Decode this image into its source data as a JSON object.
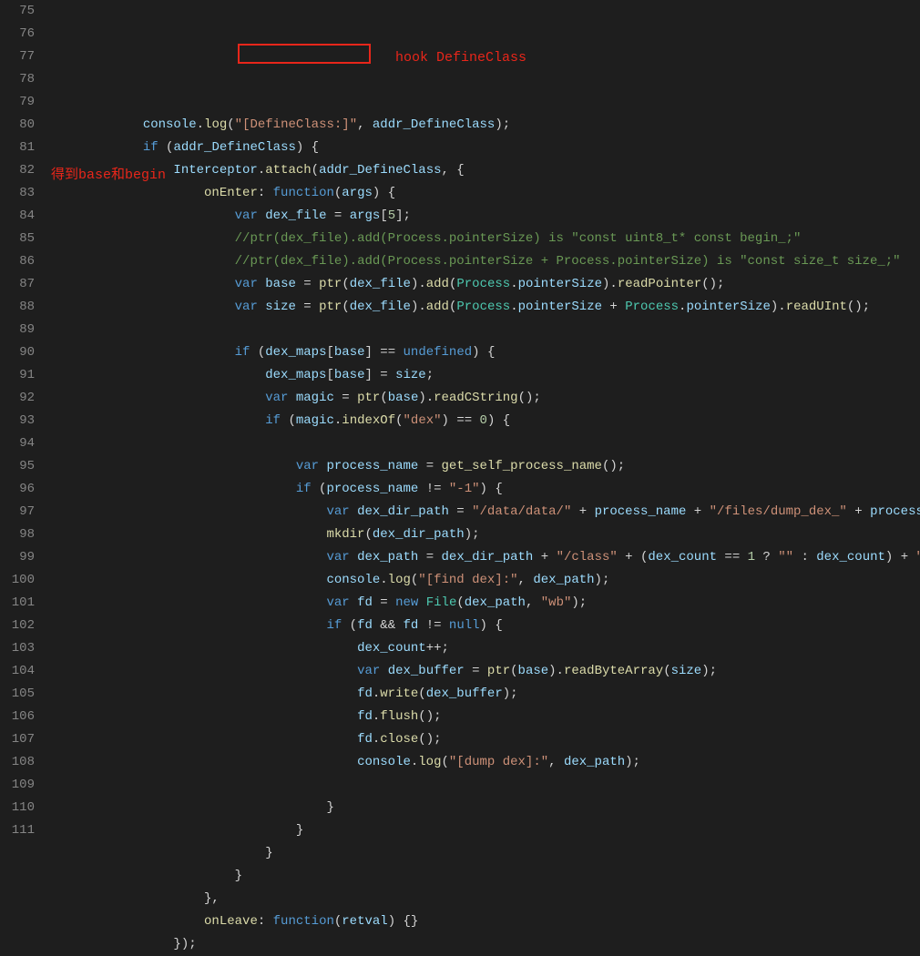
{
  "lineStart": 75,
  "lineEnd": 111,
  "annotations": {
    "a1": "hook DefineClass",
    "a2": "得到base和begin"
  },
  "tokens": {
    "l75": [
      {
        "c": "ident",
        "t": "console"
      },
      {
        "c": "pun",
        "t": "."
      },
      {
        "c": "func",
        "t": "log"
      },
      {
        "c": "pun",
        "t": "("
      },
      {
        "c": "str",
        "t": "\"[DefineClass:]\""
      },
      {
        "c": "pun",
        "t": ", "
      },
      {
        "c": "ident",
        "t": "addr_DefineClass"
      },
      {
        "c": "pun",
        "t": ");"
      }
    ],
    "l76": [
      {
        "c": "kw",
        "t": "if"
      },
      {
        "c": "pun",
        "t": " ("
      },
      {
        "c": "ident",
        "t": "addr_DefineClass"
      },
      {
        "c": "pun",
        "t": ") {"
      }
    ],
    "l77": [
      {
        "c": "ident",
        "t": "Interceptor"
      },
      {
        "c": "pun",
        "t": "."
      },
      {
        "c": "func",
        "t": "attach"
      },
      {
        "c": "pun",
        "t": "("
      },
      {
        "c": "ident",
        "t": "addr_DefineClass"
      },
      {
        "c": "pun",
        "t": ", {"
      }
    ],
    "l78": [
      {
        "c": "func",
        "t": "onEnter"
      },
      {
        "c": "pun",
        "t": ": "
      },
      {
        "c": "kw",
        "t": "function"
      },
      {
        "c": "pun",
        "t": "("
      },
      {
        "c": "ident",
        "t": "args"
      },
      {
        "c": "pun",
        "t": ") {"
      }
    ],
    "l79": [
      {
        "c": "kw",
        "t": "var"
      },
      {
        "c": "pun",
        "t": " "
      },
      {
        "c": "ident",
        "t": "dex_file"
      },
      {
        "c": "pun",
        "t": " = "
      },
      {
        "c": "ident",
        "t": "args"
      },
      {
        "c": "pun",
        "t": "["
      },
      {
        "c": "num",
        "t": "5"
      },
      {
        "c": "pun",
        "t": "];"
      }
    ],
    "l80": [
      {
        "c": "cmt",
        "t": "//ptr(dex_file).add(Process.pointerSize) is \"const uint8_t* const begin_;\""
      }
    ],
    "l81": [
      {
        "c": "cmt",
        "t": "//ptr(dex_file).add(Process.pointerSize + Process.pointerSize) is \"const size_t size_;\""
      }
    ],
    "l82": [
      {
        "c": "kw",
        "t": "var"
      },
      {
        "c": "pun",
        "t": " "
      },
      {
        "c": "ident",
        "t": "base"
      },
      {
        "c": "pun",
        "t": " = "
      },
      {
        "c": "func",
        "t": "ptr"
      },
      {
        "c": "pun",
        "t": "("
      },
      {
        "c": "ident",
        "t": "dex_file"
      },
      {
        "c": "pun",
        "t": ")."
      },
      {
        "c": "func",
        "t": "add"
      },
      {
        "c": "pun",
        "t": "("
      },
      {
        "c": "type",
        "t": "Process"
      },
      {
        "c": "pun",
        "t": "."
      },
      {
        "c": "ident",
        "t": "pointerSize"
      },
      {
        "c": "pun",
        "t": ")."
      },
      {
        "c": "func",
        "t": "readPointer"
      },
      {
        "c": "pun",
        "t": "();"
      }
    ],
    "l83": [
      {
        "c": "kw",
        "t": "var"
      },
      {
        "c": "pun",
        "t": " "
      },
      {
        "c": "ident",
        "t": "size"
      },
      {
        "c": "pun",
        "t": " = "
      },
      {
        "c": "func",
        "t": "ptr"
      },
      {
        "c": "pun",
        "t": "("
      },
      {
        "c": "ident",
        "t": "dex_file"
      },
      {
        "c": "pun",
        "t": ")."
      },
      {
        "c": "func",
        "t": "add"
      },
      {
        "c": "pun",
        "t": "("
      },
      {
        "c": "type",
        "t": "Process"
      },
      {
        "c": "pun",
        "t": "."
      },
      {
        "c": "ident",
        "t": "pointerSize"
      },
      {
        "c": "pun",
        "t": " + "
      },
      {
        "c": "type",
        "t": "Process"
      },
      {
        "c": "pun",
        "t": "."
      },
      {
        "c": "ident",
        "t": "pointerSize"
      },
      {
        "c": "pun",
        "t": ")."
      },
      {
        "c": "func",
        "t": "readUInt"
      },
      {
        "c": "pun",
        "t": "();"
      }
    ],
    "l84": [],
    "l85": [
      {
        "c": "kw",
        "t": "if"
      },
      {
        "c": "pun",
        "t": " ("
      },
      {
        "c": "ident",
        "t": "dex_maps"
      },
      {
        "c": "pun",
        "t": "["
      },
      {
        "c": "ident",
        "t": "base"
      },
      {
        "c": "pun",
        "t": "] == "
      },
      {
        "c": "undef",
        "t": "undefined"
      },
      {
        "c": "pun",
        "t": ") {"
      }
    ],
    "l86": [
      {
        "c": "ident",
        "t": "dex_maps"
      },
      {
        "c": "pun",
        "t": "["
      },
      {
        "c": "ident",
        "t": "base"
      },
      {
        "c": "pun",
        "t": "] = "
      },
      {
        "c": "ident",
        "t": "size"
      },
      {
        "c": "pun",
        "t": ";"
      }
    ],
    "l87": [
      {
        "c": "kw",
        "t": "var"
      },
      {
        "c": "pun",
        "t": " "
      },
      {
        "c": "ident",
        "t": "magic"
      },
      {
        "c": "pun",
        "t": " = "
      },
      {
        "c": "func",
        "t": "ptr"
      },
      {
        "c": "pun",
        "t": "("
      },
      {
        "c": "ident",
        "t": "base"
      },
      {
        "c": "pun",
        "t": ")."
      },
      {
        "c": "func",
        "t": "readCString"
      },
      {
        "c": "pun",
        "t": "();"
      }
    ],
    "l88": [
      {
        "c": "kw",
        "t": "if"
      },
      {
        "c": "pun",
        "t": " ("
      },
      {
        "c": "ident",
        "t": "magic"
      },
      {
        "c": "pun",
        "t": "."
      },
      {
        "c": "func",
        "t": "indexOf"
      },
      {
        "c": "pun",
        "t": "("
      },
      {
        "c": "str",
        "t": "\"dex\""
      },
      {
        "c": "pun",
        "t": ") == "
      },
      {
        "c": "num",
        "t": "0"
      },
      {
        "c": "pun",
        "t": ") {"
      }
    ],
    "l89": [],
    "l90": [
      {
        "c": "kw",
        "t": "var"
      },
      {
        "c": "pun",
        "t": " "
      },
      {
        "c": "ident",
        "t": "process_name"
      },
      {
        "c": "pun",
        "t": " = "
      },
      {
        "c": "func",
        "t": "get_self_process_name"
      },
      {
        "c": "pun",
        "t": "();"
      }
    ],
    "l91": [
      {
        "c": "kw",
        "t": "if"
      },
      {
        "c": "pun",
        "t": " ("
      },
      {
        "c": "ident",
        "t": "process_name"
      },
      {
        "c": "pun",
        "t": " != "
      },
      {
        "c": "str",
        "t": "\"-1\""
      },
      {
        "c": "pun",
        "t": ") {"
      }
    ],
    "l92": [
      {
        "c": "kw",
        "t": "var"
      },
      {
        "c": "pun",
        "t": " "
      },
      {
        "c": "ident",
        "t": "dex_dir_path"
      },
      {
        "c": "pun",
        "t": " = "
      },
      {
        "c": "str",
        "t": "\"/data/data/\""
      },
      {
        "c": "pun",
        "t": " + "
      },
      {
        "c": "ident",
        "t": "process_name"
      },
      {
        "c": "pun",
        "t": " + "
      },
      {
        "c": "str",
        "t": "\"/files/dump_dex_\""
      },
      {
        "c": "pun",
        "t": " + "
      },
      {
        "c": "ident",
        "t": "process_name"
      },
      {
        "c": "pun",
        "t": ";"
      }
    ],
    "l93": [
      {
        "c": "func",
        "t": "mkdir"
      },
      {
        "c": "pun",
        "t": "("
      },
      {
        "c": "ident",
        "t": "dex_dir_path"
      },
      {
        "c": "pun",
        "t": ");"
      }
    ],
    "l94": [
      {
        "c": "kw",
        "t": "var"
      },
      {
        "c": "pun",
        "t": " "
      },
      {
        "c": "ident",
        "t": "dex_path"
      },
      {
        "c": "pun",
        "t": " = "
      },
      {
        "c": "ident",
        "t": "dex_dir_path"
      },
      {
        "c": "pun",
        "t": " + "
      },
      {
        "c": "str",
        "t": "\"/class\""
      },
      {
        "c": "pun",
        "t": " + ("
      },
      {
        "c": "ident",
        "t": "dex_count"
      },
      {
        "c": "pun",
        "t": " == "
      },
      {
        "c": "num",
        "t": "1"
      },
      {
        "c": "pun",
        "t": " ? "
      },
      {
        "c": "str",
        "t": "\"\""
      },
      {
        "c": "pun",
        "t": " : "
      },
      {
        "c": "ident",
        "t": "dex_count"
      },
      {
        "c": "pun",
        "t": ") + "
      },
      {
        "c": "str",
        "t": "\".dex\""
      },
      {
        "c": "pun",
        "t": ";"
      }
    ],
    "l95": [
      {
        "c": "ident",
        "t": "console"
      },
      {
        "c": "pun",
        "t": "."
      },
      {
        "c": "func",
        "t": "log"
      },
      {
        "c": "pun",
        "t": "("
      },
      {
        "c": "str",
        "t": "\"[find dex]:\""
      },
      {
        "c": "pun",
        "t": ", "
      },
      {
        "c": "ident",
        "t": "dex_path"
      },
      {
        "c": "pun",
        "t": ");"
      }
    ],
    "l96": [
      {
        "c": "kw",
        "t": "var"
      },
      {
        "c": "pun",
        "t": " "
      },
      {
        "c": "ident",
        "t": "fd"
      },
      {
        "c": "pun",
        "t": " = "
      },
      {
        "c": "kw",
        "t": "new"
      },
      {
        "c": "pun",
        "t": " "
      },
      {
        "c": "type",
        "t": "File"
      },
      {
        "c": "pun",
        "t": "("
      },
      {
        "c": "ident",
        "t": "dex_path"
      },
      {
        "c": "pun",
        "t": ", "
      },
      {
        "c": "str",
        "t": "\"wb\""
      },
      {
        "c": "pun",
        "t": ");"
      }
    ],
    "l97": [
      {
        "c": "kw",
        "t": "if"
      },
      {
        "c": "pun",
        "t": " ("
      },
      {
        "c": "ident",
        "t": "fd"
      },
      {
        "c": "pun",
        "t": " && "
      },
      {
        "c": "ident",
        "t": "fd"
      },
      {
        "c": "pun",
        "t": " != "
      },
      {
        "c": "null",
        "t": "null"
      },
      {
        "c": "pun",
        "t": ") {"
      }
    ],
    "l98": [
      {
        "c": "ident",
        "t": "dex_count"
      },
      {
        "c": "pun",
        "t": "++;"
      }
    ],
    "l99": [
      {
        "c": "kw",
        "t": "var"
      },
      {
        "c": "pun",
        "t": " "
      },
      {
        "c": "ident",
        "t": "dex_buffer"
      },
      {
        "c": "pun",
        "t": " = "
      },
      {
        "c": "func",
        "t": "ptr"
      },
      {
        "c": "pun",
        "t": "("
      },
      {
        "c": "ident",
        "t": "base"
      },
      {
        "c": "pun",
        "t": ")."
      },
      {
        "c": "func",
        "t": "readByteArray"
      },
      {
        "c": "pun",
        "t": "("
      },
      {
        "c": "ident",
        "t": "size"
      },
      {
        "c": "pun",
        "t": ");"
      }
    ],
    "l100": [
      {
        "c": "ident",
        "t": "fd"
      },
      {
        "c": "pun",
        "t": "."
      },
      {
        "c": "func",
        "t": "write"
      },
      {
        "c": "pun",
        "t": "("
      },
      {
        "c": "ident",
        "t": "dex_buffer"
      },
      {
        "c": "pun",
        "t": ");"
      }
    ],
    "l101": [
      {
        "c": "ident",
        "t": "fd"
      },
      {
        "c": "pun",
        "t": "."
      },
      {
        "c": "func",
        "t": "flush"
      },
      {
        "c": "pun",
        "t": "();"
      }
    ],
    "l102": [
      {
        "c": "ident",
        "t": "fd"
      },
      {
        "c": "pun",
        "t": "."
      },
      {
        "c": "func",
        "t": "close"
      },
      {
        "c": "pun",
        "t": "();"
      }
    ],
    "l103": [
      {
        "c": "ident",
        "t": "console"
      },
      {
        "c": "pun",
        "t": "."
      },
      {
        "c": "func",
        "t": "log"
      },
      {
        "c": "pun",
        "t": "("
      },
      {
        "c": "str",
        "t": "\"[dump dex]:\""
      },
      {
        "c": "pun",
        "t": ", "
      },
      {
        "c": "ident",
        "t": "dex_path"
      },
      {
        "c": "pun",
        "t": ");"
      }
    ],
    "l104": [],
    "l105": [
      {
        "c": "pun",
        "t": "}"
      }
    ],
    "l106": [
      {
        "c": "pun",
        "t": "}"
      }
    ],
    "l107": [
      {
        "c": "pun",
        "t": "}"
      }
    ],
    "l108": [
      {
        "c": "pun",
        "t": "}"
      }
    ],
    "l109": [
      {
        "c": "pun",
        "t": "},"
      }
    ],
    "l110": [
      {
        "c": "func",
        "t": "onLeave"
      },
      {
        "c": "pun",
        "t": ": "
      },
      {
        "c": "kw",
        "t": "function"
      },
      {
        "c": "pun",
        "t": "("
      },
      {
        "c": "ident",
        "t": "retval"
      },
      {
        "c": "pun",
        "t": ") {}"
      }
    ],
    "l111": [
      {
        "c": "pun",
        "t": "});"
      }
    ]
  },
  "indents": {
    "l75": 3,
    "l76": 3,
    "l77": 4,
    "l78": 5,
    "l79": 6,
    "l80": 6,
    "l81": 6,
    "l82": 6,
    "l83": 6,
    "l84": 0,
    "l85": 6,
    "l86": 7,
    "l87": 7,
    "l88": 7,
    "l89": 0,
    "l90": 8,
    "l91": 8,
    "l92": 9,
    "l93": 9,
    "l94": 9,
    "l95": 9,
    "l96": 9,
    "l97": 9,
    "l98": 10,
    "l99": 10,
    "l100": 10,
    "l101": 10,
    "l102": 10,
    "l103": 10,
    "l104": 0,
    "l105": 9,
    "l106": 8,
    "l107": 7,
    "l108": 6,
    "l109": 5,
    "l110": 5,
    "l111": 4
  }
}
